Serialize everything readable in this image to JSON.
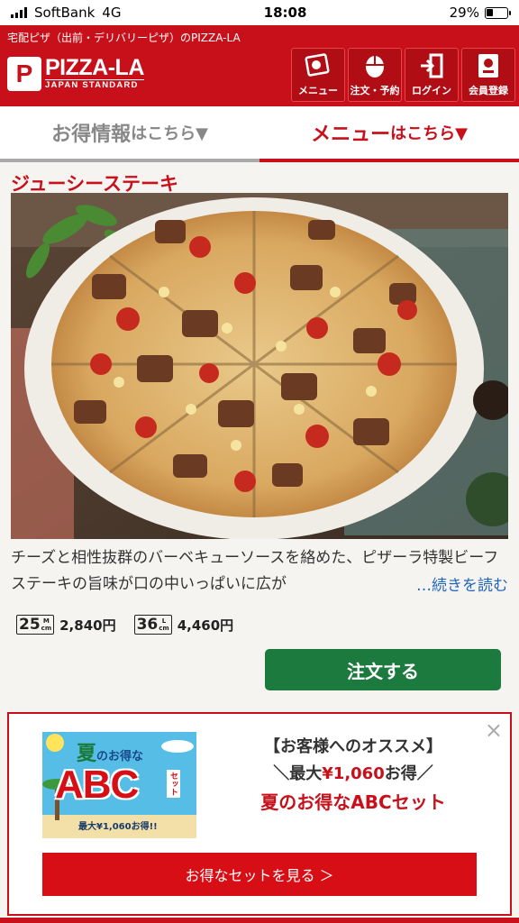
{
  "status_bar": {
    "carrier": "SoftBank",
    "network": "4G",
    "time": "18:08",
    "battery": "29%",
    "battery_level": 0.29
  },
  "header": {
    "tagline": "宅配ピザ（出前・デリバリーピザ）のPIZZA-LA",
    "logo_mark": "P",
    "logo_title": "PIZZA-LA",
    "logo_subtitle": "JAPAN STANDARD",
    "nav": [
      {
        "label": "メニュー",
        "icon": "menu-icon"
      },
      {
        "label": "注文・予約",
        "icon": "mouse-icon"
      },
      {
        "label": "ログイン",
        "icon": "login-icon"
      },
      {
        "label": "会員登録",
        "icon": "member-icon"
      }
    ]
  },
  "tabs": {
    "deals": {
      "big": "お得情報",
      "small": "はこちら▼"
    },
    "menu": {
      "big": "メニュー",
      "small": "はこちら▼"
    }
  },
  "product": {
    "name": "ジューシーステーキ",
    "description": "チーズと相性抜群のバーベキューソースを絡めた、ピザーラ特製ビーフステーキの旨味が口の中いっぱいに広が",
    "read_more": "…続きを読む",
    "sizes": [
      {
        "num": "25",
        "unit_top": "M",
        "unit_bottom": "cm",
        "price": "2,840円"
      },
      {
        "num": "36",
        "unit_top": "L",
        "unit_bottom": "cm",
        "price": "4,460円"
      }
    ],
    "order_label": "注文する"
  },
  "promo": {
    "close": "×",
    "banner": {
      "title_big": "夏",
      "title_rest": "のお得な",
      "abc": "ABC",
      "set": "セット",
      "sub": "最大¥1,060お得!!"
    },
    "line1": "【お客様へのオススメ】",
    "line2_pre": "＼最大",
    "line2_amount": "¥1,060",
    "line2_post": "お得／",
    "line3": "夏のお得なABCセット",
    "cta": "お得なセットを見る ＞"
  },
  "colors": {
    "brand_red": "#c8101a",
    "order_green": "#1d7a3f",
    "link_blue": "#2266bb"
  }
}
